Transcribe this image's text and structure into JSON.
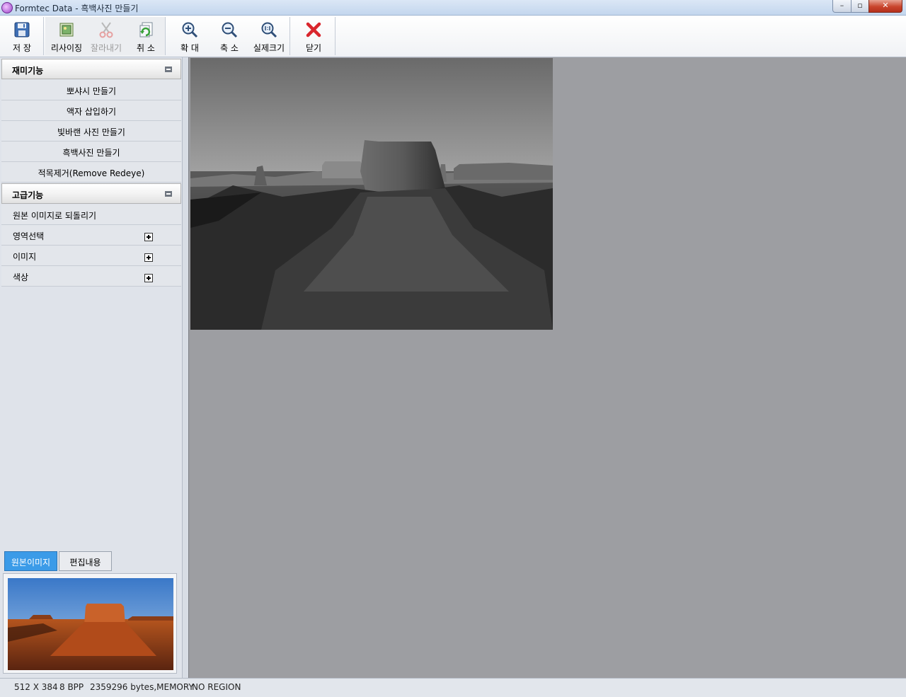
{
  "window": {
    "title": "Formtec Data - 흑백사진 만들기",
    "controls": {
      "minimize": "–",
      "maximize": "▫",
      "close": "✕"
    }
  },
  "toolbar": {
    "save": "저  장",
    "resize": "리사이징",
    "cut": "잘라내기",
    "undo": "취  소",
    "zoom_in": "확  대",
    "zoom_out": "축  소",
    "actual_size": "실제크기",
    "close": "닫기"
  },
  "sidebar": {
    "fun_section": {
      "title": "재미기능",
      "items": [
        "뽀샤시 만들기",
        "액자 삽입하기",
        "빛바랜 사진 만들기",
        "흑백사진 만들기",
        "적목제거(Remove Redeye)"
      ]
    },
    "advanced_section": {
      "title": "고급기능",
      "items": [
        "원본 이미지로 되돌리기",
        "영역선택",
        "이미지",
        "색상"
      ]
    }
  },
  "tabs": {
    "original": "원본이미지",
    "edits": "편집내용"
  },
  "status": {
    "dimensions": "512 X 384",
    "bpp": "8 BPP",
    "memory": "2359296 bytes,MEMORY",
    "region": "NO REGION"
  },
  "colors": {
    "accent_tab": "#3b9be8",
    "close_icon": "#d9262d",
    "canvas_bg": "#9d9ea2"
  },
  "icons": {
    "save": "floppy-disk-icon",
    "resize": "resize-image-icon",
    "cut": "scissors-icon",
    "undo": "undo-document-icon",
    "zoom_in": "zoom-in-icon",
    "zoom_out": "zoom-out-icon",
    "actual_size": "actual-size-icon",
    "close": "red-x-icon"
  }
}
